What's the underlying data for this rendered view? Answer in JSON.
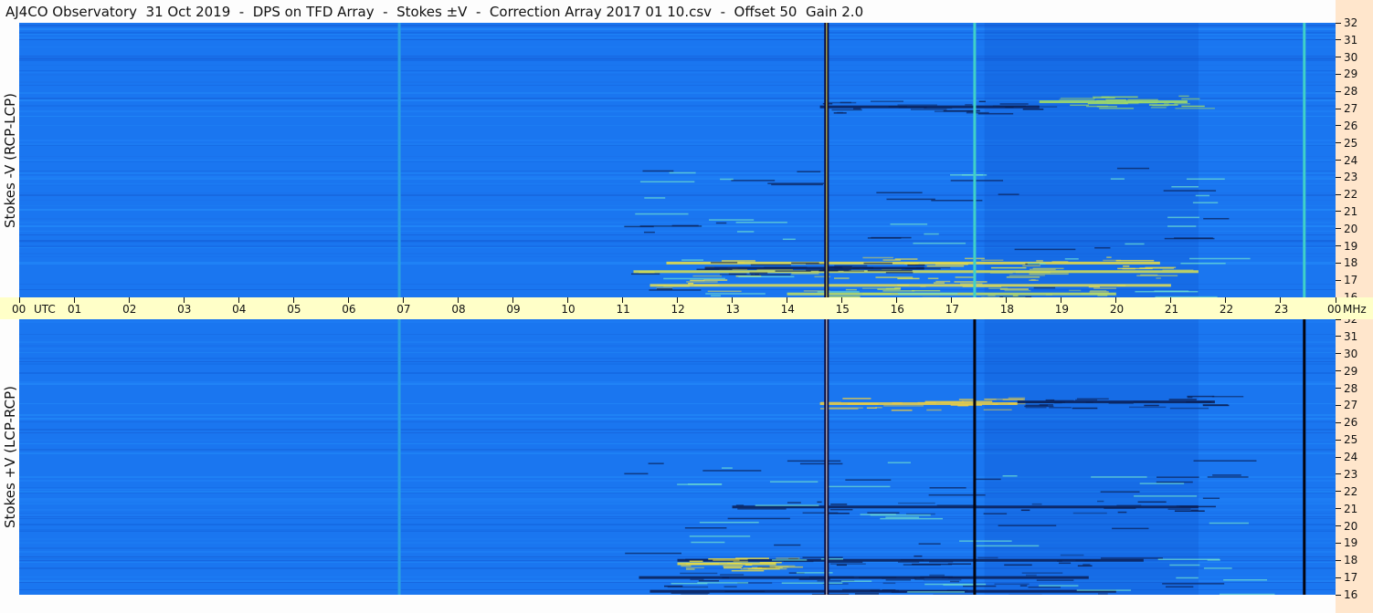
{
  "title": "AJ4CO Observatory  31 Oct 2019  -  DPS on TFD Array  -  Stokes ±V  -  Correction Array 2017 01 10.csv  -  Offset 50  Gain 2.0",
  "chart_data": [
    {
      "type": "heatmap",
      "ylabel": "Stokes -V (RCP-LCP)",
      "x_ticks": [
        "00",
        "01",
        "02",
        "03",
        "04",
        "05",
        "06",
        "07",
        "08",
        "09",
        "10",
        "11",
        "12",
        "13",
        "14",
        "15",
        "16",
        "17",
        "18",
        "19",
        "20",
        "21",
        "22",
        "23",
        "00"
      ],
      "x_unit": "UTC",
      "y_ticks": [
        16,
        17,
        18,
        19,
        20,
        21,
        22,
        23,
        24,
        25,
        26,
        27,
        28,
        29,
        30,
        31,
        32
      ],
      "y_unit": "MHz",
      "xlim": [
        0,
        24
      ],
      "ylim": [
        16,
        32
      ],
      "features": {
        "vertical_lines": [
          {
            "t": 14.72,
            "color": "#0a0a3a",
            "core": "#ffff60"
          },
          {
            "t": 17.42,
            "color": "#40d0c8"
          },
          {
            "t": 23.43,
            "color": "#40d0c8"
          },
          {
            "t": 6.93,
            "color": "#2aa0e0"
          }
        ],
        "bands": [
          {
            "t0": 14.6,
            "t1": 18.6,
            "f": 27.1,
            "color": "#0a1f55"
          },
          {
            "t0": 18.6,
            "t1": 21.3,
            "f": 27.4,
            "color": "#a8e060"
          },
          {
            "t0": 11.2,
            "t1": 21.5,
            "f": 17.5,
            "color": "#d8e050"
          },
          {
            "t0": 11.8,
            "t1": 20.8,
            "f": 18.0,
            "color": "#f0e040"
          },
          {
            "t0": 11.5,
            "t1": 21.0,
            "f": 16.7,
            "color": "#e8e050"
          },
          {
            "t0": 14.0,
            "t1": 20.0,
            "f": 16.2,
            "color": "#c0e060"
          },
          {
            "t0": 12.5,
            "t1": 16.5,
            "f": 17.7,
            "color": "#0a1f55"
          }
        ]
      }
    },
    {
      "type": "heatmap",
      "ylabel": "Stokes +V (LCP-RCP)",
      "x_ticks": [
        "00",
        "01",
        "02",
        "03",
        "04",
        "05",
        "06",
        "07",
        "08",
        "09",
        "10",
        "11",
        "12",
        "13",
        "14",
        "15",
        "16",
        "17",
        "18",
        "19",
        "20",
        "21",
        "22",
        "23",
        "00"
      ],
      "x_unit": "UTC",
      "y_ticks": [
        16,
        17,
        18,
        19,
        20,
        21,
        22,
        23,
        24,
        25,
        26,
        27,
        28,
        29,
        30,
        31,
        32
      ],
      "y_unit": "MHz",
      "xlim": [
        0,
        24
      ],
      "ylim": [
        16,
        32
      ],
      "features": {
        "vertical_lines": [
          {
            "t": 14.72,
            "color": "#0a0a3a",
            "core": "#ffffff"
          },
          {
            "t": 17.42,
            "color": "#050510"
          },
          {
            "t": 23.43,
            "color": "#050510"
          },
          {
            "t": 6.93,
            "color": "#2aa0e0"
          }
        ],
        "bands": [
          {
            "t0": 14.6,
            "t1": 18.2,
            "f": 27.1,
            "color": "#f0d040"
          },
          {
            "t0": 18.2,
            "t1": 21.8,
            "f": 27.2,
            "color": "#0a1f55"
          },
          {
            "t0": 12.0,
            "t1": 20.5,
            "f": 18.0,
            "color": "#0a1f55"
          },
          {
            "t0": 11.3,
            "t1": 19.5,
            "f": 17.0,
            "color": "#0a1f55"
          },
          {
            "t0": 12.0,
            "t1": 13.8,
            "f": 17.8,
            "color": "#f0e040"
          },
          {
            "t0": 13.0,
            "t1": 21.5,
            "f": 21.1,
            "color": "#0a1f55"
          },
          {
            "t0": 11.5,
            "t1": 20.0,
            "f": 16.2,
            "color": "#0a1f55"
          }
        ]
      }
    }
  ],
  "colors": {
    "background_blue": "#1a76f0",
    "axis_time_bg": "#ffffc8",
    "axis_freq_bg": "#ffe6cc"
  }
}
